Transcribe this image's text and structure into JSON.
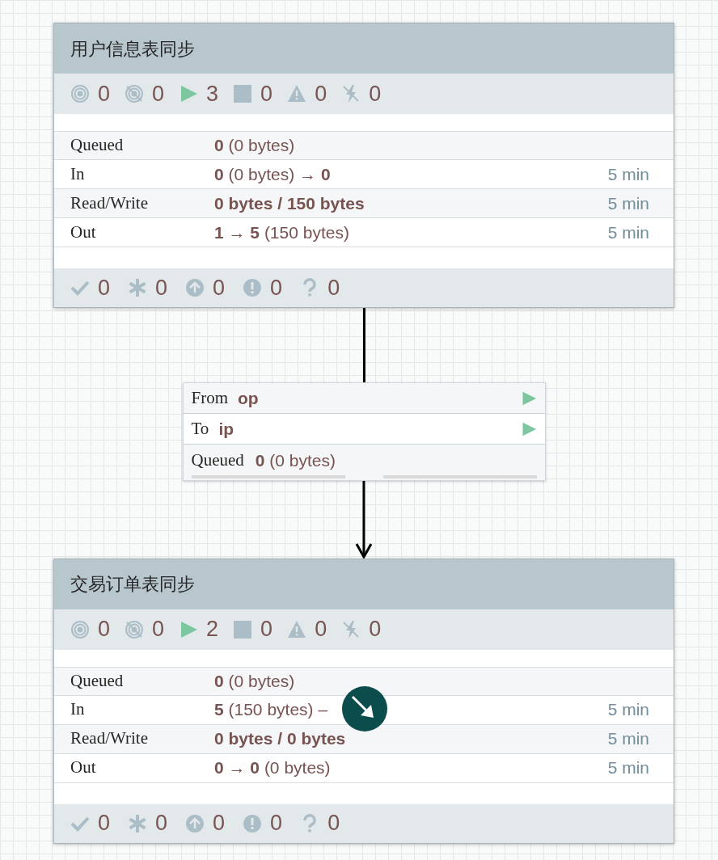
{
  "process_groups": [
    {
      "title": "用户信息表同步",
      "stats": [
        {
          "kind": "transmitting",
          "value": "0"
        },
        {
          "kind": "not-transmitting",
          "value": "0"
        },
        {
          "kind": "running",
          "value": "3"
        },
        {
          "kind": "stopped",
          "value": "0"
        },
        {
          "kind": "invalid",
          "value": "0"
        },
        {
          "kind": "disabled",
          "value": "0"
        }
      ],
      "rows": [
        {
          "label": "Queued",
          "value": "**0** (0 bytes)"
        },
        {
          "label": "In",
          "value": "**0** (0 bytes) → **0**",
          "time": "5 min"
        },
        {
          "label": "Read/Write",
          "value": "**0 bytes / 150 bytes**",
          "time": "5 min"
        },
        {
          "label": "Out",
          "value": "**1** → **5** (150 bytes)",
          "time": "5 min"
        }
      ],
      "footer": [
        {
          "kind": "up-to-date",
          "value": "0"
        },
        {
          "kind": "locally-modified",
          "value": "0"
        },
        {
          "kind": "stale",
          "value": "0"
        },
        {
          "kind": "sync-failure",
          "value": "0"
        },
        {
          "kind": "unknown",
          "value": "0"
        }
      ]
    },
    {
      "title": "交易订单表同步",
      "stats": [
        {
          "kind": "transmitting",
          "value": "0"
        },
        {
          "kind": "not-transmitting",
          "value": "0"
        },
        {
          "kind": "running",
          "value": "2"
        },
        {
          "kind": "stopped",
          "value": "0"
        },
        {
          "kind": "invalid",
          "value": "0"
        },
        {
          "kind": "disabled",
          "value": "0"
        }
      ],
      "rows": [
        {
          "label": "Queued",
          "value": "**0** (0 bytes)"
        },
        {
          "label": "In",
          "value": "**5** (150 bytes) –",
          "time": "5 min"
        },
        {
          "label": "Read/Write",
          "value": "**0 bytes / 0 bytes**",
          "time": "5 min"
        },
        {
          "label": "Out",
          "value": "**0** → **0** (0 bytes)",
          "time": "5 min"
        }
      ],
      "footer": [
        {
          "kind": "up-to-date",
          "value": "0"
        },
        {
          "kind": "locally-modified",
          "value": "0"
        },
        {
          "kind": "stale",
          "value": "0"
        },
        {
          "kind": "sync-failure",
          "value": "0"
        },
        {
          "kind": "unknown",
          "value": "0"
        }
      ]
    }
  ],
  "connection": {
    "rows": [
      {
        "label": "From",
        "value": "op",
        "running": true
      },
      {
        "label": "To",
        "value": "ip",
        "running": true
      }
    ],
    "queued": {
      "label": "Queued",
      "value": "**0** (0 bytes)"
    },
    "bars": [
      {
        "level": 0
      },
      {
        "level": 0
      }
    ]
  }
}
